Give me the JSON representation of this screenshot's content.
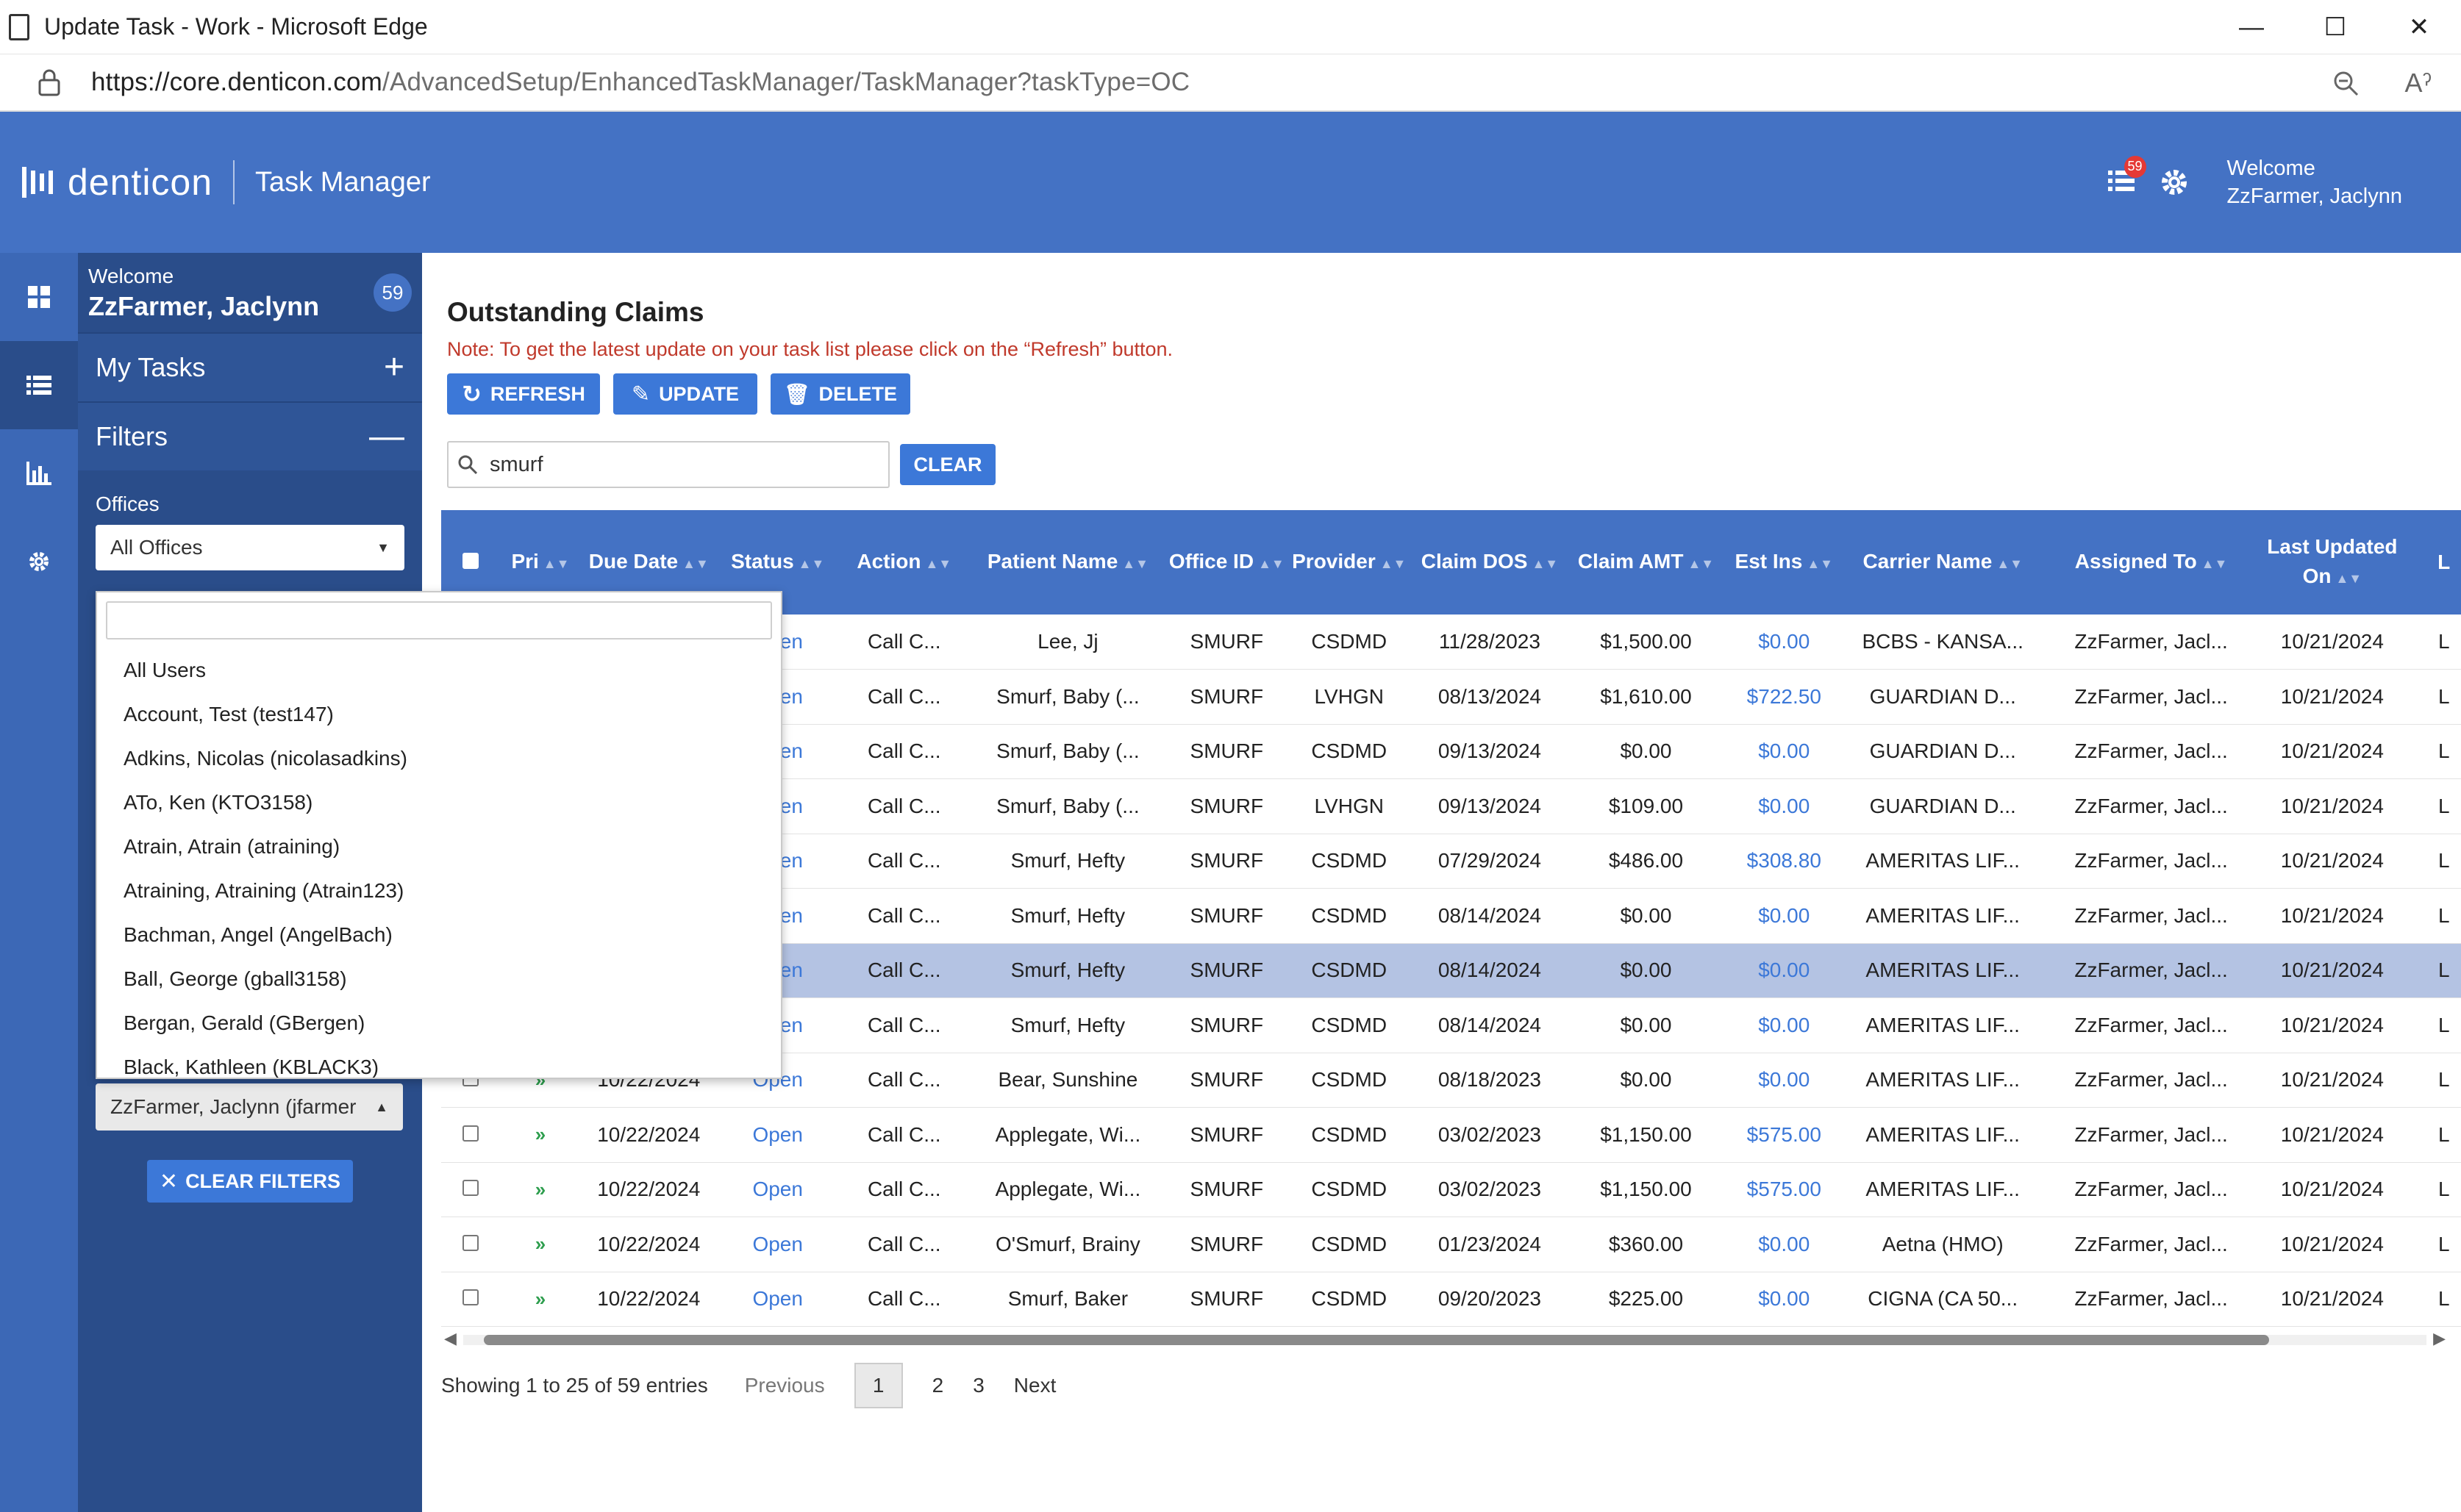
{
  "browser": {
    "title": "Update Task - Work - Microsoft Edge",
    "url_host": "https://core.denticon.com",
    "url_path": "/AdvancedSetup/EnhancedTaskManager/TaskManager?taskType=OC"
  },
  "header": {
    "brand": "denticon",
    "app_name": "Task Manager",
    "notif_count": "59",
    "welcome_line1": "Welcome",
    "welcome_line2": "ZzFarmer, Jaclynn"
  },
  "sidebar": {
    "welcome_small": "Welcome",
    "welcome_name": "ZzFarmer, Jaclynn",
    "task_count": "59",
    "my_tasks": "My Tasks",
    "filters": "Filters",
    "offices_label": "Offices",
    "offices_value": "All Offices",
    "assigned_value": "ZzFarmer, Jaclynn (jfarmer",
    "clear_filters": "CLEAR FILTERS"
  },
  "dropdown": {
    "items": [
      "All Users",
      "Account, Test (test147)",
      "Adkins, Nicolas (nicolasadkins)",
      "ATo, Ken (KTO3158)",
      "Atrain, Atrain (atraining)",
      "Atraining, Atraining (Atrain123)",
      "Bachman, Angel (AngelBach)",
      "Ball, George (gball3158)",
      "Bergan, Gerald (GBergen)",
      "Black, Kathleen (KBLACK3)"
    ]
  },
  "main": {
    "title": "Outstanding Claims",
    "note": "Note: To get the latest update on your task list please click on the “Refresh” button.",
    "refresh": "REFRESH",
    "update": "UPDATE",
    "delete": "DELETE",
    "search_value": "smurf",
    "clear": "CLEAR"
  },
  "table": {
    "headers": [
      "Pri",
      "Due Date",
      "Status",
      "Action",
      "Patient Name",
      "Office ID",
      "Provider",
      "Claim DOS",
      "Claim AMT",
      "Est Ins",
      "Carrier Name",
      "Assigned To",
      "Last Updated On",
      "L"
    ],
    "rows": [
      [
        "",
        "",
        "Open",
        "Call C...",
        "Lee, Jj",
        "SMURF",
        "CSDMD",
        "11/28/2023",
        "$1,500.00",
        "$0.00",
        "BCBS - KANSA...",
        "ZzFarmer, Jacl...",
        "10/21/2024",
        "L"
      ],
      [
        "",
        "",
        "Open",
        "Call C...",
        "Smurf, Baby (...",
        "SMURF",
        "LVHGN",
        "08/13/2024",
        "$1,610.00",
        "$722.50",
        "GUARDIAN D...",
        "ZzFarmer, Jacl...",
        "10/21/2024",
        "L"
      ],
      [
        "",
        "",
        "Open",
        "Call C...",
        "Smurf, Baby (...",
        "SMURF",
        "CSDMD",
        "09/13/2024",
        "$0.00",
        "$0.00",
        "GUARDIAN D...",
        "ZzFarmer, Jacl...",
        "10/21/2024",
        "L"
      ],
      [
        "",
        "",
        "Open",
        "Call C...",
        "Smurf, Baby (...",
        "SMURF",
        "LVHGN",
        "09/13/2024",
        "$109.00",
        "$0.00",
        "GUARDIAN D...",
        "ZzFarmer, Jacl...",
        "10/21/2024",
        "L"
      ],
      [
        "",
        "",
        "Open",
        "Call C...",
        "Smurf, Hefty",
        "SMURF",
        "CSDMD",
        "07/29/2024",
        "$486.00",
        "$308.80",
        "AMERITAS LIF...",
        "ZzFarmer, Jacl...",
        "10/21/2024",
        "L"
      ],
      [
        "",
        "",
        "Open",
        "Call C...",
        "Smurf, Hefty",
        "SMURF",
        "CSDMD",
        "08/14/2024",
        "$0.00",
        "$0.00",
        "AMERITAS LIF...",
        "ZzFarmer, Jacl...",
        "10/21/2024",
        "L"
      ],
      [
        "",
        "",
        "Open",
        "Call C...",
        "Smurf, Hefty",
        "SMURF",
        "CSDMD",
        "08/14/2024",
        "$0.00",
        "$0.00",
        "AMERITAS LIF...",
        "ZzFarmer, Jacl...",
        "10/21/2024",
        "L"
      ],
      [
        "",
        "",
        "Open",
        "Call C...",
        "Smurf, Hefty",
        "SMURF",
        "CSDMD",
        "08/14/2024",
        "$0.00",
        "$0.00",
        "AMERITAS LIF...",
        "ZzFarmer, Jacl...",
        "10/21/2024",
        "L"
      ],
      [
        "»",
        "10/22/2024",
        "Open",
        "Call C...",
        "Bear, Sunshine",
        "SMURF",
        "CSDMD",
        "08/18/2023",
        "$0.00",
        "$0.00",
        "AMERITAS LIF...",
        "ZzFarmer, Jacl...",
        "10/21/2024",
        "L"
      ],
      [
        "»",
        "10/22/2024",
        "Open",
        "Call C...",
        "Applegate, Wi...",
        "SMURF",
        "CSDMD",
        "03/02/2023",
        "$1,150.00",
        "$575.00",
        "AMERITAS LIF...",
        "ZzFarmer, Jacl...",
        "10/21/2024",
        "L"
      ],
      [
        "»",
        "10/22/2024",
        "Open",
        "Call C...",
        "Applegate, Wi...",
        "SMURF",
        "CSDMD",
        "03/02/2023",
        "$1,150.00",
        "$575.00",
        "AMERITAS LIF...",
        "ZzFarmer, Jacl...",
        "10/21/2024",
        "L"
      ],
      [
        "»",
        "10/22/2024",
        "Open",
        "Call C...",
        "O'Smurf, Brainy",
        "SMURF",
        "CSDMD",
        "01/23/2024",
        "$360.00",
        "$0.00",
        "Aetna (HMO)",
        "ZzFarmer, Jacl...",
        "10/21/2024",
        "L"
      ],
      [
        "»",
        "10/22/2024",
        "Open",
        "Call C...",
        "Smurf, Baker",
        "SMURF",
        "CSDMD",
        "09/20/2023",
        "$225.00",
        "$0.00",
        "CIGNA (CA 50...",
        "ZzFarmer, Jacl...",
        "10/21/2024",
        "L"
      ]
    ],
    "selected_row": 6
  },
  "pager": {
    "info": "Showing 1 to 25 of 59 entries",
    "previous": "Previous",
    "pages": [
      "1",
      "2",
      "3"
    ],
    "next": "Next"
  },
  "colors": {
    "header_blue": "#4472c4",
    "sidebar_dark": "#2a4d8a",
    "button_blue": "#3c78d8",
    "note_red": "#c0392b"
  }
}
